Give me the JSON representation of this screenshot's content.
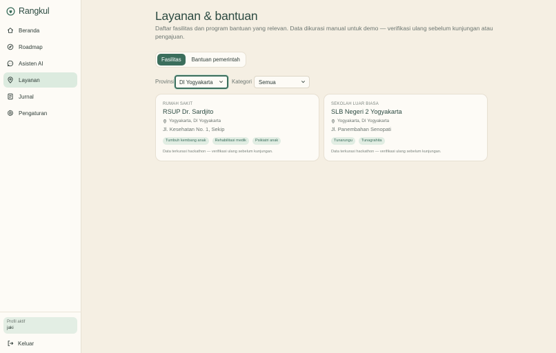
{
  "app": {
    "name": "Rangkul",
    "logo_icon": "heart-leaf-logo"
  },
  "colors": {
    "accent": "#3b6e5c",
    "background": "#f5efe3",
    "sidebar": "#fdfbf6",
    "active_nav": "#dcebdf",
    "tag_bg": "#e1ede3"
  },
  "sidebar": {
    "items": [
      {
        "label": "Beranda",
        "icon": "home-icon",
        "active": false
      },
      {
        "label": "Roadmap",
        "icon": "compass-icon",
        "active": false
      },
      {
        "label": "Asisten AI",
        "icon": "chat-icon",
        "active": false
      },
      {
        "label": "Layanan",
        "icon": "map-pin-icon",
        "active": true
      },
      {
        "label": "Jurnal",
        "icon": "journal-icon",
        "active": false
      },
      {
        "label": "Pengaturan",
        "icon": "gear-icon",
        "active": false
      }
    ],
    "profile": {
      "caption": "Profil aktif",
      "name": "jaki"
    },
    "logout_label": "Keluar"
  },
  "main": {
    "title": "Layanan & bantuan",
    "subtitle": "Daftar fasilitas dan program bantuan yang relevan. Data dikurasi manual untuk demo — verifikasi ulang sebelum kunjungan atau pengajuan.",
    "tabs": [
      {
        "label": "Fasilitas",
        "active": true
      },
      {
        "label": "Bantuan pemerintah",
        "active": false
      }
    ],
    "filters": {
      "province_label": "Provinsi",
      "province_value": "DI Yogyakarta",
      "category_label": "Kategori",
      "category_value": "Semua"
    },
    "cards": [
      {
        "kind": "RUMAH SAKIT",
        "name": "RSUP Dr. Sardjito",
        "location": "Yogyakarta, DI Yogyakarta",
        "address": "Jl. Kesehatan No. 1, Sekip",
        "tags": [
          "Tumbuh kembang anak",
          "Rehabilitasi medik",
          "Psikiatri anak"
        ],
        "note": "Data terkurasi hackathon — verifikasi ulang sebelum kunjungan."
      },
      {
        "kind": "SEKOLAH LUAR BIASA",
        "name": "SLB Negeri 2 Yogyakarta",
        "location": "Yogyakarta, DI Yogyakarta",
        "address": "Jl. Panembahan Senopati",
        "tags": [
          "Tunarungu",
          "Tunagrahita"
        ],
        "note": "Data terkurasi hackathon — verifikasi ulang sebelum kunjungan."
      }
    ]
  }
}
